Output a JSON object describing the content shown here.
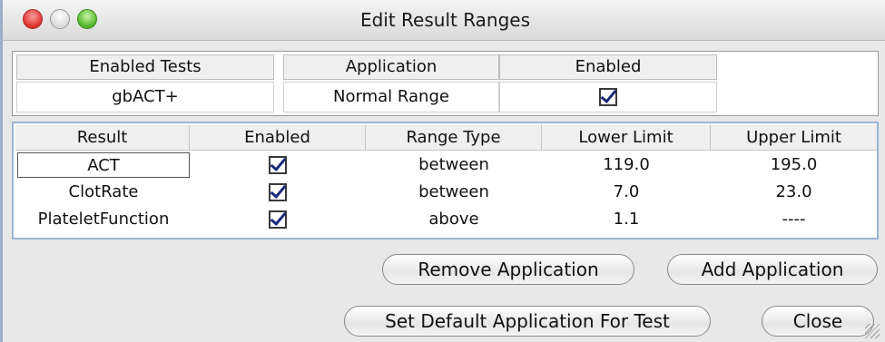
{
  "window": {
    "title": "Edit Result Ranges"
  },
  "tests": {
    "header": "Enabled Tests",
    "value": "gbACT+"
  },
  "application": {
    "header_app": "Application",
    "header_enabled": "Enabled",
    "value": "Normal Range",
    "enabled": true
  },
  "results": {
    "headers": [
      "Result",
      "Enabled",
      "Range Type",
      "Lower Limit",
      "Upper Limit"
    ],
    "rows": [
      {
        "result": "ACT",
        "enabled": true,
        "range_type": "between",
        "lower": "119.0",
        "upper": "195.0"
      },
      {
        "result": "ClotRate",
        "enabled": true,
        "range_type": "between",
        "lower": "7.0",
        "upper": "23.0"
      },
      {
        "result": "PlateletFunction",
        "enabled": true,
        "range_type": "above",
        "lower": "1.1",
        "upper": "----"
      }
    ]
  },
  "buttons": {
    "remove": "Remove Application",
    "add": "Add Application",
    "set_default": "Set Default Application For Test",
    "close": "Close"
  }
}
